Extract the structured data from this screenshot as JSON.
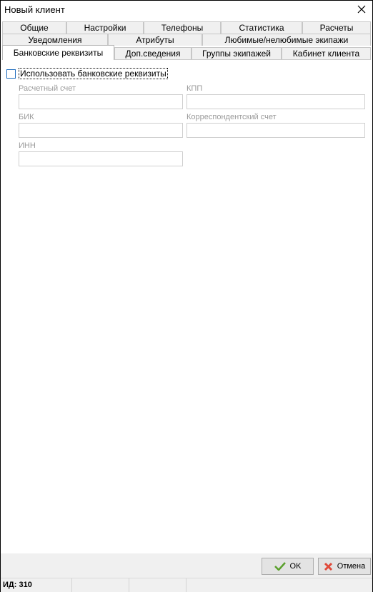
{
  "window": {
    "title": "Новый клиент"
  },
  "tabs": {
    "row1": [
      "Общие",
      "Настройки",
      "Телефоны",
      "Статистика",
      "Расчеты"
    ],
    "row2": [
      "Уведомления",
      "Атрибуты",
      "Любимые/нелюбимые экипажи"
    ],
    "row3": [
      "Банковские реквизиты",
      "Доп.сведения",
      "Группы экипажей",
      "Кабинет клиента"
    ],
    "active": "Банковские реквизиты"
  },
  "bank": {
    "use_checkbox_label": "Использовать банковские реквизиты",
    "use_checkbox_checked": false,
    "account_label": "Расчетный счет",
    "account_value": "",
    "kpp_label": "КПП",
    "kpp_value": "",
    "bik_label": "БИК",
    "bik_value": "",
    "corr_account_label": "Корреспондентский счет",
    "corr_account_value": "",
    "inn_label": "ИНН",
    "inn_value": ""
  },
  "buttons": {
    "ok_label": "OK",
    "cancel_label": "Отмена"
  },
  "status": {
    "id_text": "ИД: 310"
  },
  "icons": {
    "ok": "checkmark-icon",
    "cancel": "red-x-icon",
    "close": "close-icon"
  },
  "colors": {
    "checkbox_border": "#1c6bbd",
    "ok_icon": "#5aa02c",
    "cancel_icon": "#e04a3a"
  }
}
